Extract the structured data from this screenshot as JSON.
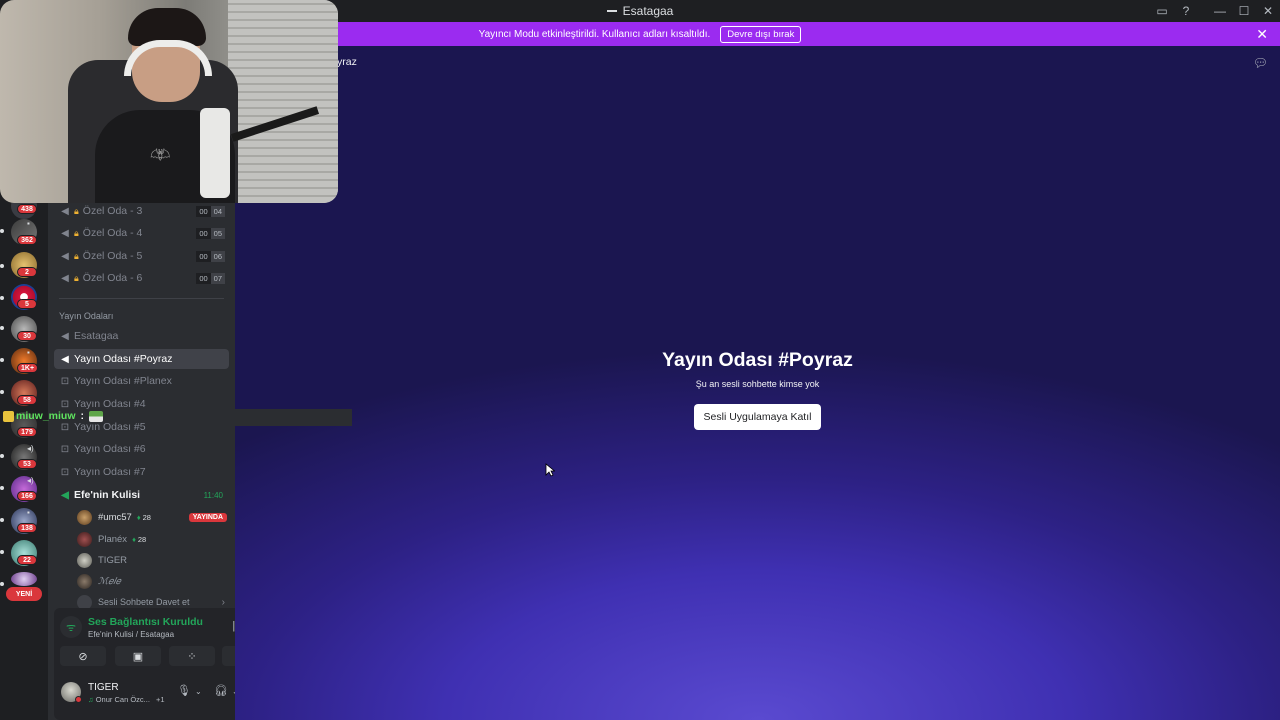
{
  "window": {
    "title": "Esatagaa",
    "icons": [
      "inbox-icon",
      "help-icon",
      "minimize-icon",
      "maximize-icon",
      "close-icon"
    ]
  },
  "banner": {
    "message": "Yayıncı Modu etkinleştirildi. Kullanıcı adları kısaltıldı.",
    "button": "Devre dışı bırak"
  },
  "server_rail": {
    "badges": [
      "438",
      "362",
      "2",
      "5",
      "30",
      "1K+",
      "58",
      "179",
      "53",
      "166",
      "138",
      "22"
    ],
    "new_label": "YENİ"
  },
  "channels": {
    "private": [
      {
        "name": "Özel Oda - 3",
        "limit_a": "00",
        "limit_b": "04"
      },
      {
        "name": "Özel Oda - 4",
        "limit_a": "00",
        "limit_b": "05"
      },
      {
        "name": "Özel Oda - 5",
        "limit_a": "00",
        "limit_b": "06"
      },
      {
        "name": "Özel Oda - 6",
        "limit_a": "00",
        "limit_b": "07"
      }
    ],
    "category": "Yayın Odaları",
    "stream_rooms": [
      {
        "name": "Esatagaa"
      },
      {
        "name": "Yayın Odası #Poyraz"
      },
      {
        "name": "Yayın Odası #Planex"
      },
      {
        "name": "Yayın Odası #4"
      },
      {
        "name": "Yayın Odası #5"
      },
      {
        "name": "Yayın Odası #6"
      },
      {
        "name": "Yayın Odası #7"
      }
    ],
    "active_room": {
      "name": "Efe'nin Kulisi",
      "time": "11:40"
    },
    "voice_users": [
      {
        "name": "#umc57",
        "gems": "28",
        "live": "YAYINDA"
      },
      {
        "name": "Planéx",
        "gems": "28"
      },
      {
        "name": "TIGER"
      },
      {
        "name": "ℳ𝑒𝑙𝑒"
      }
    ],
    "invite": "Sesli Sohbete Davet et"
  },
  "voice_panel": {
    "status": "Ses Bağlantısı Kuruldu",
    "location": "Efe'nin Kulisi / Esatagaa"
  },
  "user": {
    "name": "TIGER",
    "status": "Onur Can Özc...",
    "extra": "+1"
  },
  "main": {
    "channel_header": "yraz",
    "stage_title": "Yayın Odası #Poyraz",
    "stage_subtitle": "Şu an sesli sohbette kimse yok",
    "join_button": "Sesli Uygulamaya Katıl"
  },
  "overlay_chat": {
    "username": "miuw_miuw",
    "separator": ":"
  },
  "colors": {
    "banner": "#9b2bf0",
    "accent_green": "#23a55a",
    "badge_red": "#da373c",
    "sidebar": "#2b2d31",
    "rail": "#1e1f22"
  }
}
